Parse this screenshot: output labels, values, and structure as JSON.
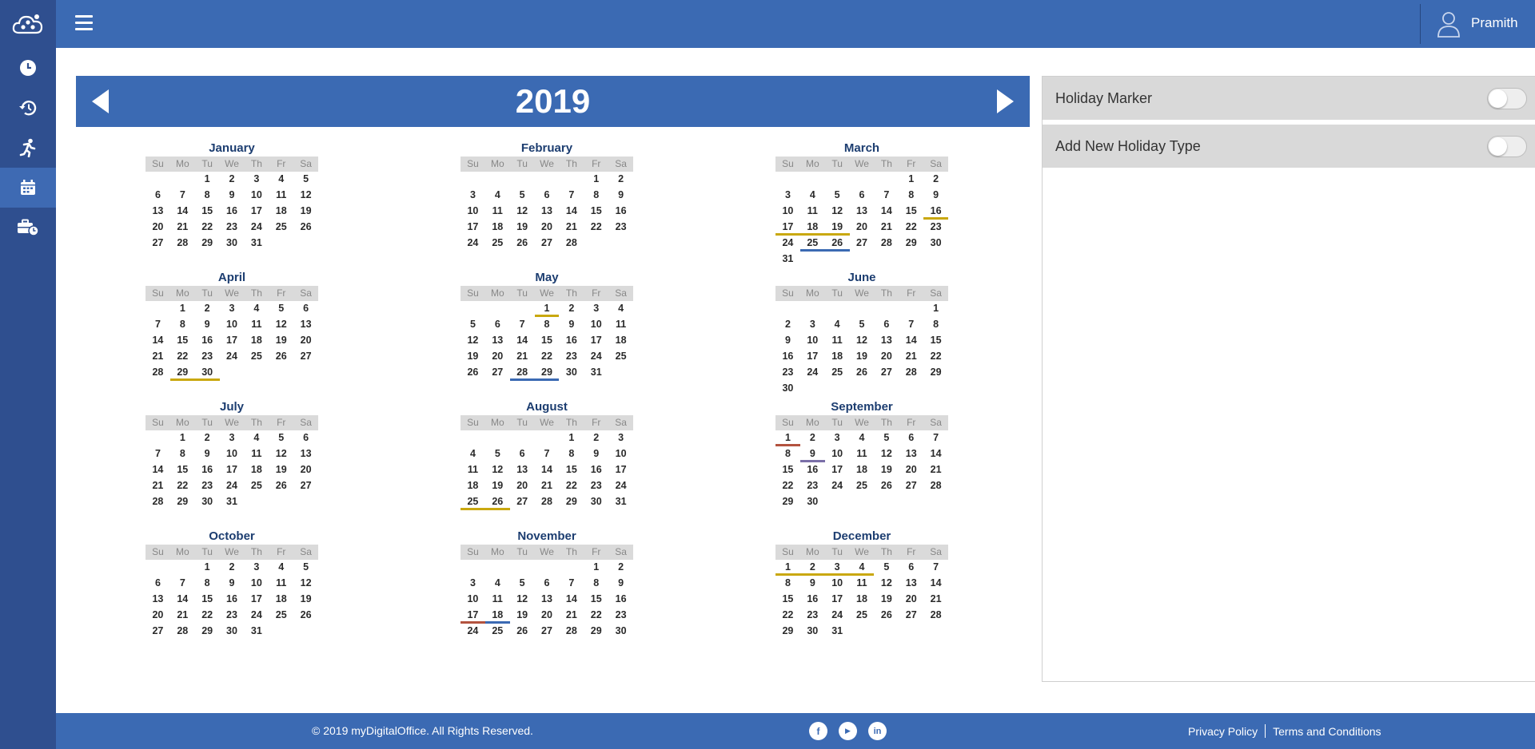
{
  "user": {
    "name": "Pramith"
  },
  "year": "2019",
  "weekdays": [
    "Su",
    "Mo",
    "Tu",
    "We",
    "Th",
    "Fr",
    "Sa"
  ],
  "months": [
    {
      "name": "January",
      "start": 2,
      "days": 31,
      "marks": {}
    },
    {
      "name": "February",
      "start": 5,
      "days": 28,
      "marks": {}
    },
    {
      "name": "March",
      "start": 5,
      "days": 31,
      "marks": {
        "16": "#c9a80f",
        "17": "#c9a80f",
        "18": "#c9a80f",
        "19": "#c9a80f",
        "25": "#3b6ab3",
        "26": "#3b6ab3"
      }
    },
    {
      "name": "April",
      "start": 1,
      "days": 30,
      "marks": {
        "29": "#c9a80f",
        "30": "#c9a80f"
      }
    },
    {
      "name": "May",
      "start": 3,
      "days": 31,
      "marks": {
        "1": "#c9a80f",
        "28": "#3b6ab3",
        "29": "#3b6ab3"
      }
    },
    {
      "name": "June",
      "start": 6,
      "days": 30,
      "marks": {}
    },
    {
      "name": "July",
      "start": 1,
      "days": 31,
      "marks": {}
    },
    {
      "name": "August",
      "start": 4,
      "days": 31,
      "marks": {
        "25": "#c9a80f",
        "26": "#c9a80f"
      }
    },
    {
      "name": "September",
      "start": 0,
      "days": 30,
      "marks": {
        "1": "#b3533f",
        "9": "#7a6fa8"
      }
    },
    {
      "name": "October",
      "start": 2,
      "days": 31,
      "marks": {}
    },
    {
      "name": "November",
      "start": 5,
      "days": 30,
      "marks": {
        "17": "#b3533f",
        "18": "#3b6ab3"
      }
    },
    {
      "name": "December",
      "start": 0,
      "days": 31,
      "marks": {
        "1": "#c9a80f",
        "2": "#c9a80f",
        "3": "#c9a80f",
        "4": "#c9a80f"
      }
    }
  ],
  "panel": {
    "holiday_marker_label": "Holiday Marker",
    "add_holiday_type_label": "Add New Holiday Type"
  },
  "footer": {
    "copyright": "© 2019 myDigitalOffice. All Rights Reserved.",
    "facebook": "f",
    "youtube": "▶",
    "linkedin": "in",
    "privacy": "Privacy Policy",
    "terms": "Terms and Conditions"
  }
}
